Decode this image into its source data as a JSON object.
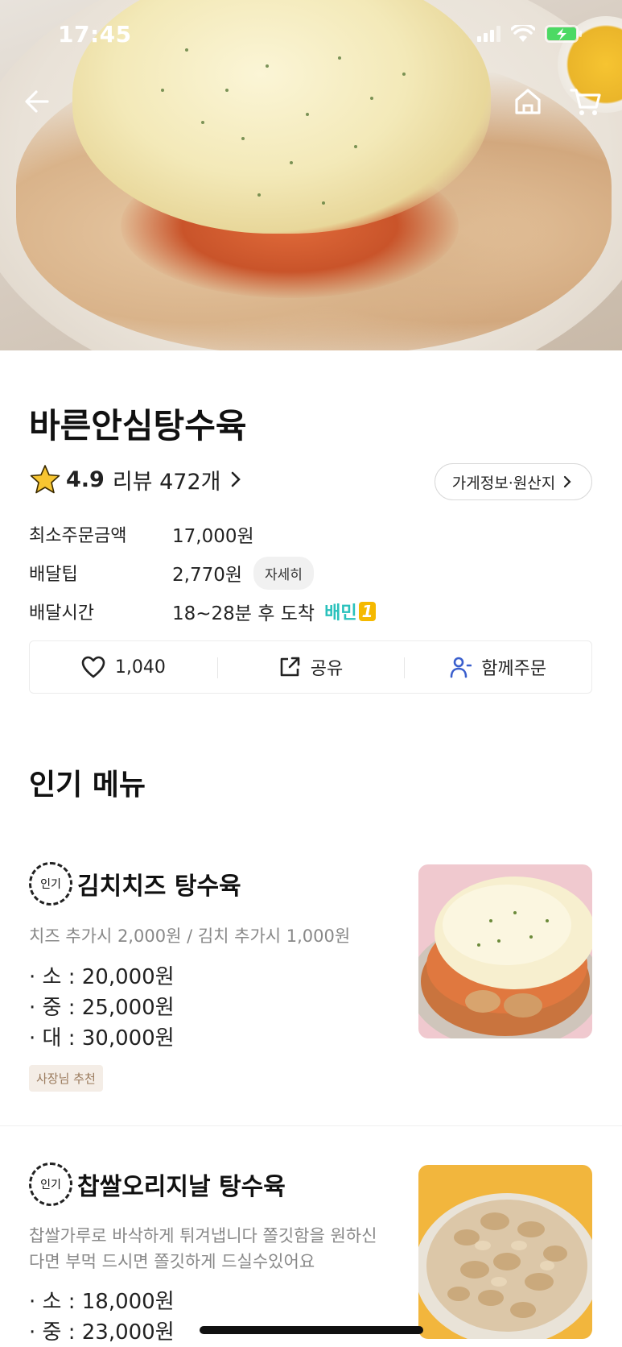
{
  "status_bar": {
    "time": "17:45"
  },
  "store": {
    "name": "바른안심탕수육",
    "rating": "4.9",
    "review_label": "리뷰 472개",
    "info_button": "가게정보·원산지"
  },
  "meta": {
    "min_order_label": "최소주문금액",
    "min_order_value": "17,000원",
    "delivery_tip_label": "배달팁",
    "delivery_tip_value": "2,770원",
    "detail_chip": "자세히",
    "delivery_time_label": "배달시간",
    "delivery_time_value": "18~28분 후 도착",
    "baemin_one_text": "배민",
    "baemin_one_digit": "1"
  },
  "actions": {
    "like_count": "1,040",
    "share_label": "공유",
    "group_label": "함께주문"
  },
  "section_title": "인기 메뉴",
  "popular_badge": "인기",
  "menu": [
    {
      "name": "김치치즈 탕수육",
      "description": "치즈 추가시 2,000원 / 김치 추가시 1,000원",
      "prices": [
        "· 소 : 20,000원",
        "· 중 : 25,000원",
        "· 대 : 30,000원"
      ],
      "tag": "사장님 추천"
    },
    {
      "name": "찹쌀오리지날 탕수육",
      "description": "찹쌀가루로 바삭하게 튀겨냅니다 쫄깃함을 원하신다면 부먹 드시면 쫄깃하게 드실수있어요",
      "prices": [
        "· 소 : 18,000원",
        "· 중 : 23,000원"
      ]
    }
  ],
  "icons": {
    "back": "back-arrow-icon",
    "home": "home-icon",
    "cart": "cart-icon",
    "star": "star-icon",
    "heart": "heart-icon",
    "share": "share-icon",
    "person": "person-icon",
    "chevron": "chevron-right-icon"
  },
  "colors": {
    "baemin_teal": "#2ac1bc",
    "star_yellow": "#f7c531",
    "person_blue": "#3a5fcd",
    "owner_chip_bg": "#f4ede6"
  }
}
